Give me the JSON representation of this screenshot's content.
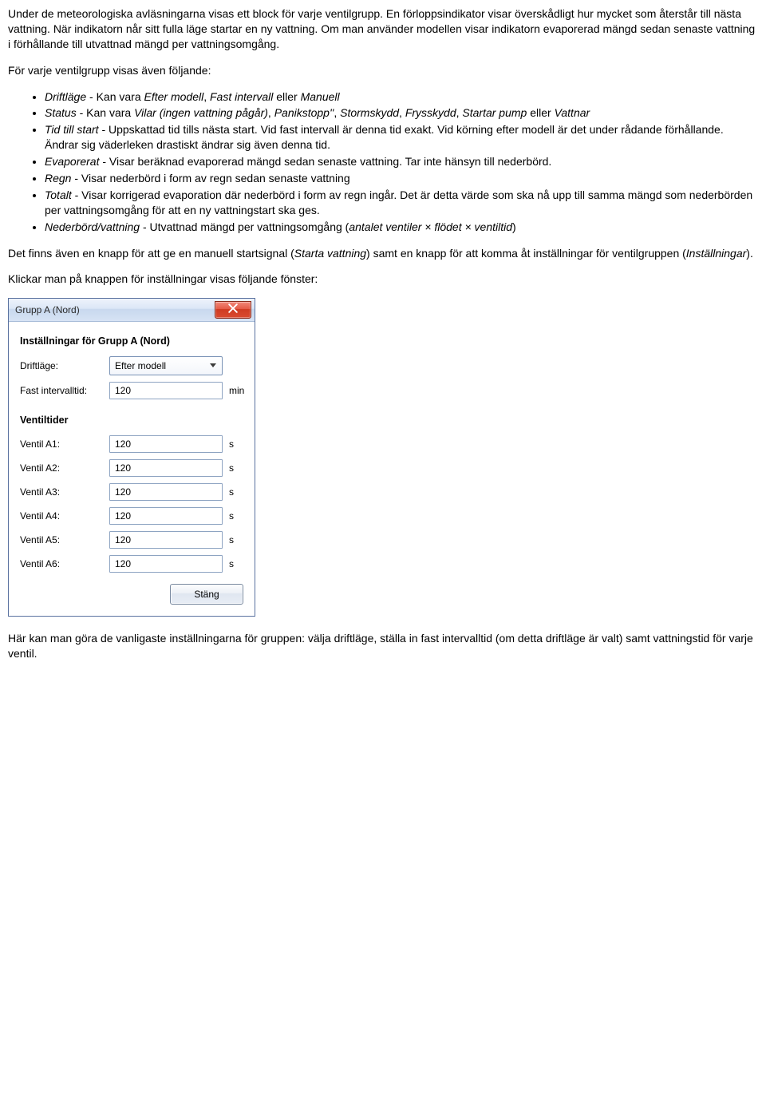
{
  "para1": "Under de meteorologiska avläsningarna visas ett block för varje ventilgrupp. En förloppsindikator visar överskådligt hur mycket som återstår till nästa vattning. När indikatorn når sitt fulla läge startar en ny vattning. Om man använder modellen visar indikatorn evaporerad mängd sedan senaste vattning i förhållande till utvattnad mängd per vattningsomgång.",
  "para2": "För varje ventilgrupp visas även följande:",
  "bullets": {
    "b1a": "Driftläge",
    "b1b": " - Kan vara ",
    "b1c": "Efter modell",
    "b1d": ", ",
    "b1e": "Fast intervall",
    "b1f": " eller ",
    "b1g": "Manuell",
    "b2a": "Status",
    "b2b": " - Kan vara ",
    "b2c": "Vilar (ingen vattning pågår)",
    "b2d": ", ",
    "b2e": "Panikstopp''",
    "b2f": ", ",
    "b2g": "Stormskydd",
    "b2h": ", ",
    "b2i": "Frysskydd",
    "b2j": ", ",
    "b2k": "Startar pump",
    "b2l": " eller ",
    "b2m": "Vattnar",
    "b3a": "Tid till start",
    "b3b": " - Uppskattad tid tills nästa start. Vid fast intervall är denna tid exakt. Vid körning efter modell är det under rådande förhållande. Ändrar sig väderleken drastiskt ändrar sig även denna tid.",
    "b4a": "Evaporerat",
    "b4b": " - Visar beräknad evaporerad mängd sedan senaste vattning. Tar inte hänsyn till nederbörd.",
    "b5a": "Regn",
    "b5b": " - Visar nederbörd i form av regn sedan senaste vattning",
    "b6a": "Totalt",
    "b6b": " - Visar korrigerad evaporation där nederbörd i form av regn ingår. Det är detta värde som ska nå upp till samma mängd som nederbörden per vattningsomgång för att en ny vattningstart ska ges.",
    "b7a": "Nederbörd/vattning",
    "b7b": " - Utvattnad mängd per vattningsomgång (",
    "b7c": "antalet ventiler × flödet × ventiltid",
    "b7d": ")"
  },
  "para3a": "Det finns även en knapp för att ge en manuell startsignal (",
  "para3b": "Starta vattning",
  "para3c": ") samt en knapp för att komma åt inställningar för ventilgruppen (",
  "para3d": "Inställningar",
  "para3e": ").",
  "para4": "Klickar man på knappen för inställningar visas följande fönster:",
  "dialog": {
    "title": "Grupp A (Nord)",
    "heading": "Inställningar för Grupp A (Nord)",
    "driftlage_label": "Driftläge:",
    "driftlage_value": "Efter modell",
    "fastintervall_label": "Fast intervalltid:",
    "fastintervall_value": "120",
    "fastintervall_unit": "min",
    "ventiltider_heading": "Ventiltider",
    "ventils": [
      {
        "label": "Ventil A1:",
        "value": "120",
        "unit": "s"
      },
      {
        "label": "Ventil A2:",
        "value": "120",
        "unit": "s"
      },
      {
        "label": "Ventil A3:",
        "value": "120",
        "unit": "s"
      },
      {
        "label": "Ventil A4:",
        "value": "120",
        "unit": "s"
      },
      {
        "label": "Ventil A5:",
        "value": "120",
        "unit": "s"
      },
      {
        "label": "Ventil A6:",
        "value": "120",
        "unit": "s"
      }
    ],
    "close_button": "Stäng"
  },
  "para5": "Här kan man göra de vanligaste inställningarna för gruppen: välja driftläge, ställa in fast intervalltid (om detta driftläge är valt) samt vattningstid för varje ventil."
}
